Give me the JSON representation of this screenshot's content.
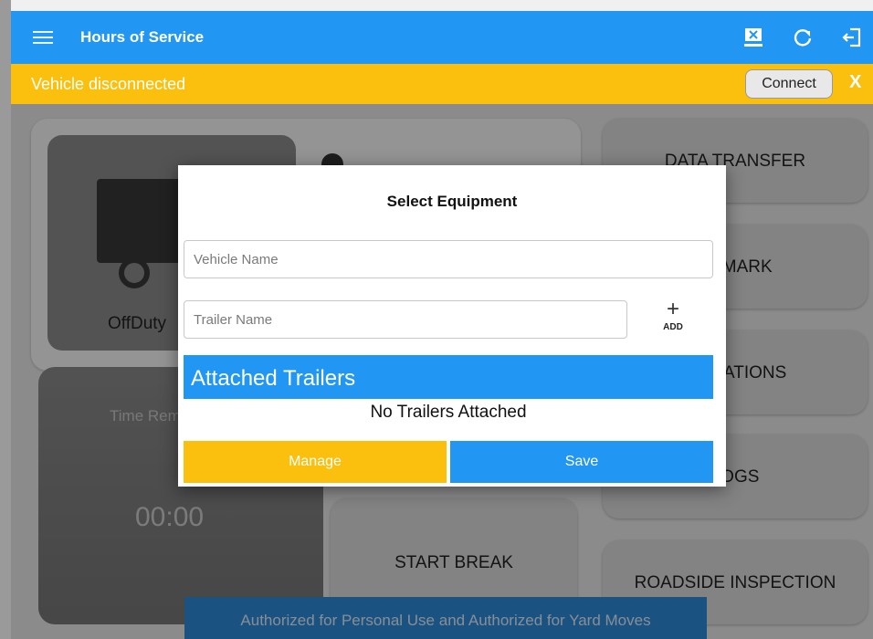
{
  "app_bar": {
    "title": "Hours of Service",
    "icons": [
      "menu-icon",
      "transfer-icon",
      "refresh-icon",
      "logout-icon"
    ]
  },
  "banner": {
    "message": "Vehicle disconnected",
    "connect_label": "Connect",
    "close_label": "X"
  },
  "background": {
    "status_label": "OffDuty",
    "time_label": "Time Remaining",
    "time_value": "00:00",
    "start_break_label": "START BREAK",
    "menu_tiles": [
      {
        "label": "DATA TRANSFER"
      },
      {
        "label": "REMARK"
      },
      {
        "label": "VIOLATIONS"
      },
      {
        "label": "LOGS"
      },
      {
        "label": "ROADSIDE INSPECTION"
      }
    ],
    "footer_text": "Authorized for Personal Use and Authorized for Yard Moves"
  },
  "dialog": {
    "title": "Select Equipment",
    "vehicle_placeholder": "Vehicle Name",
    "trailer_placeholder": "Trailer Name",
    "add_label": "ADD",
    "attached_header": "Attached Trailers",
    "empty_message": "No Trailers Attached",
    "manage_label": "Manage",
    "save_label": "Save"
  },
  "colors": {
    "primary": "#2196f3",
    "warning": "#fbbf0d"
  }
}
